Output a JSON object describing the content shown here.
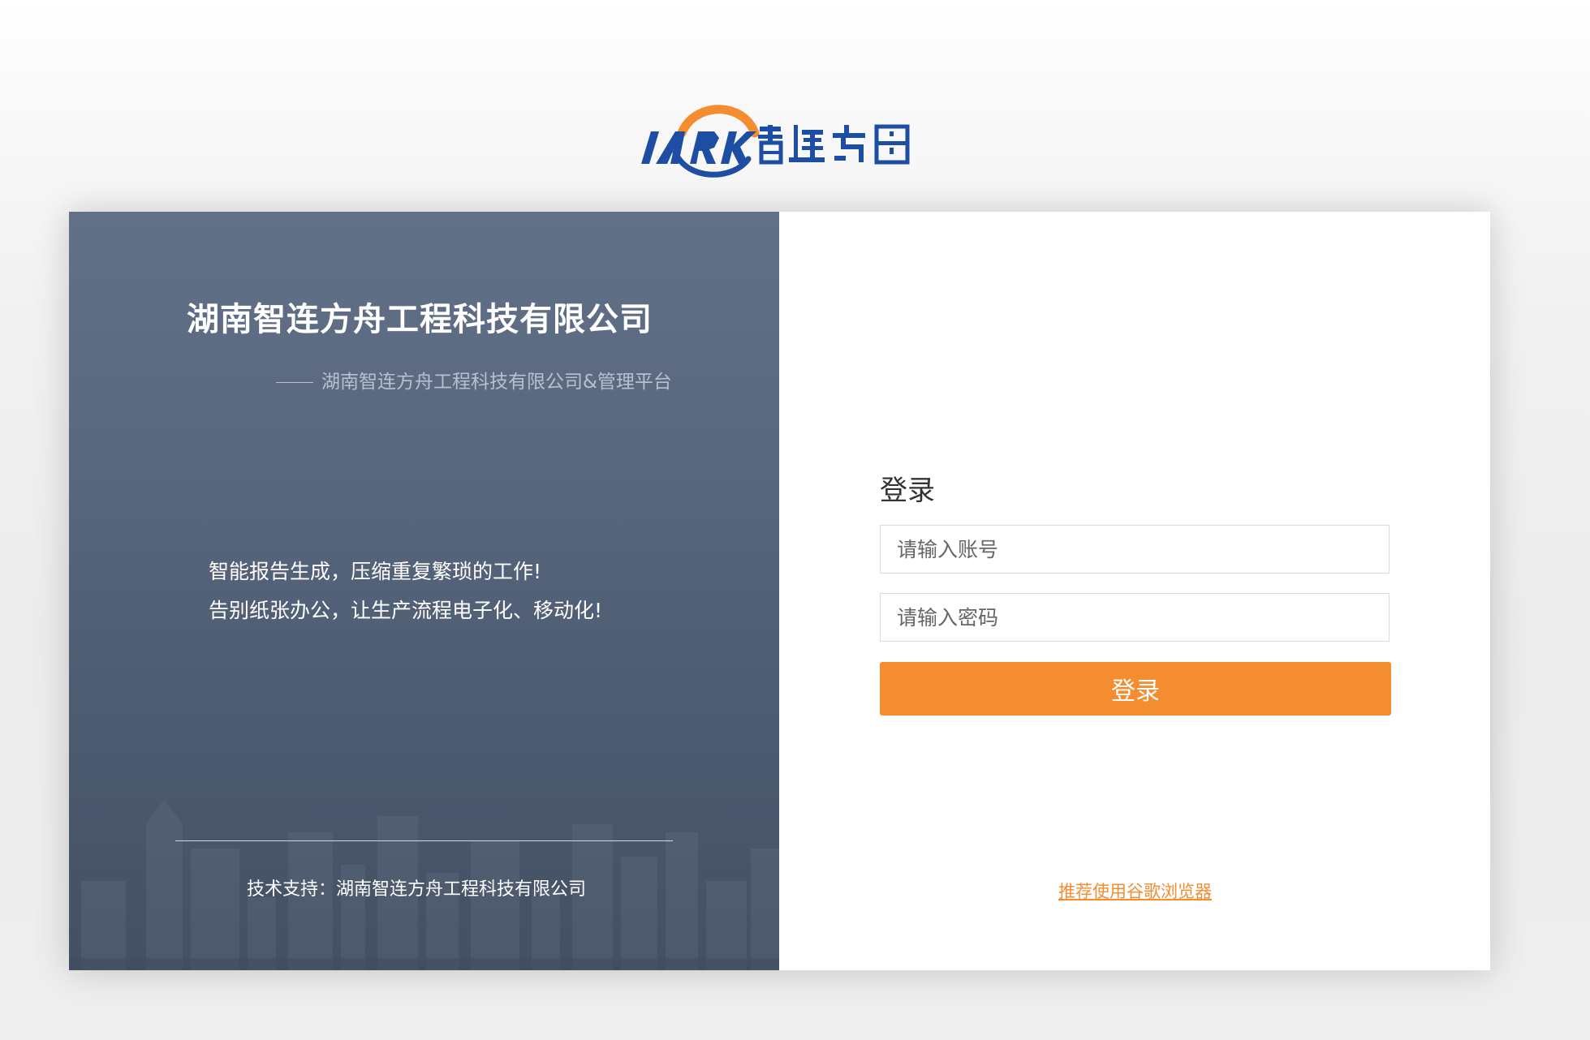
{
  "logo": {
    "brand_latin": "IARK",
    "brand_cn": "智连方舟",
    "colors": {
      "blue": "#1d4ea3",
      "orange": "#f38d30"
    }
  },
  "left_panel": {
    "company_title": "湖南智连方舟工程科技有限公司",
    "subtitle": "湖南智连方舟工程科技有限公司&管理平台",
    "slogan_lines": [
      "智能报告生成，压缩重复繁琐的工作!",
      "告别纸张办公，让生产流程电子化、移动化!"
    ],
    "tech_support": "技术支持：湖南智连方舟工程科技有限公司"
  },
  "login": {
    "heading": "登录",
    "account_placeholder": "请输入账号",
    "password_placeholder": "请输入密码",
    "submit_label": "登录",
    "browser_tip": "推荐使用谷歌浏览器"
  },
  "colors": {
    "accent": "#f38d30",
    "panel_top": "#627188",
    "panel_bottom": "#445063"
  }
}
